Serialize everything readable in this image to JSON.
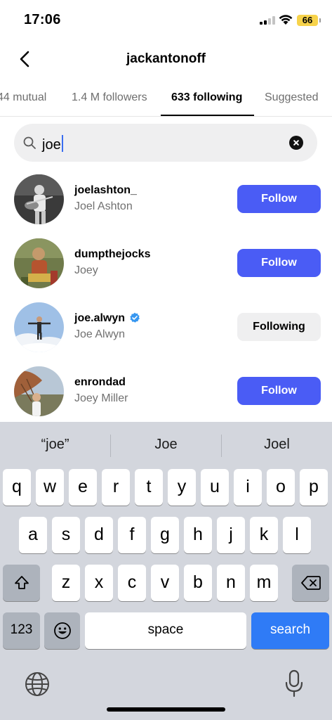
{
  "status_bar": {
    "time": "17:06",
    "battery": "66"
  },
  "header": {
    "title": "jackantonoff"
  },
  "tabs": [
    {
      "label": "44 mutual",
      "active": false
    },
    {
      "label": "1.4 M followers",
      "active": false
    },
    {
      "label": "633 following",
      "active": true
    },
    {
      "label": "Suggested",
      "active": false
    }
  ],
  "search": {
    "value": "joe"
  },
  "users": [
    {
      "username": "joelashton_",
      "name": "Joel Ashton",
      "action": "Follow",
      "verified": false
    },
    {
      "username": "dumpthejocks",
      "name": "Joey",
      "action": "Follow",
      "verified": false
    },
    {
      "username": "joe.alwyn",
      "name": "Joe Alwyn",
      "action": "Following",
      "verified": true
    },
    {
      "username": "enrondad",
      "name": "Joey Miller",
      "action": "Follow",
      "verified": false
    }
  ],
  "keyboard": {
    "suggestions": [
      "“joe”",
      "Joe",
      "Joel"
    ],
    "row1": [
      "q",
      "w",
      "e",
      "r",
      "t",
      "y",
      "u",
      "i",
      "o",
      "p"
    ],
    "row2": [
      "a",
      "s",
      "d",
      "f",
      "g",
      "h",
      "j",
      "k",
      "l"
    ],
    "row3": [
      "z",
      "x",
      "c",
      "v",
      "b",
      "n",
      "m"
    ],
    "numbers_key": "123",
    "space_key": "space",
    "search_key": "search"
  },
  "colors": {
    "follow_button": "#4a5cf5",
    "following_button": "#efeff0",
    "search_key": "#2f7bf6",
    "verified_badge": "#3797f0",
    "battery": "#f7d34b"
  }
}
